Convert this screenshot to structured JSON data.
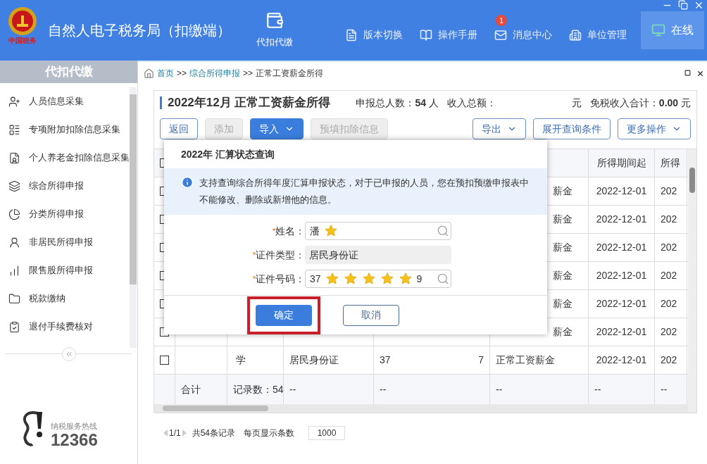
{
  "header": {
    "logo_caption": "中国税务",
    "title": "自然人电子税务局（扣缴端）",
    "module": {
      "label": "代扣代缴",
      "selected": true
    },
    "menu": [
      {
        "label": "版本切换"
      },
      {
        "label": "操作手册"
      },
      {
        "label": "消息中心",
        "badge": "1"
      },
      {
        "label": "单位管理"
      }
    ],
    "status": {
      "label": "在线",
      "online": true
    }
  },
  "sidebar": {
    "title": "代扣代缴",
    "items": [
      {
        "label": "人员信息采集"
      },
      {
        "label": "专项附加扣除信息采集"
      },
      {
        "label": "个人养老金扣除信息采集"
      },
      {
        "label": "综合所得申报"
      },
      {
        "label": "分类所得申报"
      },
      {
        "label": "非居民所得申报"
      },
      {
        "label": "限售股所得申报"
      },
      {
        "label": "税款缴纳"
      },
      {
        "label": "退付手续费核对"
      }
    ],
    "hotline": {
      "label": "纳税服务热线",
      "number": "12366"
    }
  },
  "breadcrumb": [
    {
      "label": "首页",
      "link": true
    },
    {
      "label": ">>",
      "link": false
    },
    {
      "label": "综合所得申报",
      "link": true
    },
    {
      "label": ">>",
      "link": false
    },
    {
      "label": "正常工资薪金所得",
      "link": false
    }
  ],
  "panel": {
    "title": "2022年12月 正常工资薪金所得",
    "summary": [
      "申报总人数：**54** 人",
      "收入总额：",
      "元",
      "免税收入合计：**0.00** 元"
    ],
    "toolbar": {
      "left": [
        {
          "label": "返回",
          "primary": false,
          "disabled": false,
          "dropdown": false
        },
        {
          "label": "添加",
          "primary": false,
          "disabled": true,
          "dropdown": false
        },
        {
          "label": "导入",
          "primary": true,
          "disabled": false,
          "dropdown": true
        },
        {
          "label": "预填扣除信息",
          "primary": false,
          "disabled": true,
          "dropdown": false
        }
      ],
      "right": [
        {
          "label": "导出",
          "primary": false,
          "disabled": false,
          "dropdown": true
        },
        {
          "label": "展开查询条件",
          "primary": false,
          "disabled": false,
          "dropdown": false
        },
        {
          "label": "更多操作",
          "primary": false,
          "disabled": false,
          "dropdown": true
        }
      ]
    },
    "table": {
      "header_checked": false,
      "columns": {
        "col7": "所得期间起",
        "col8": "所得"
      },
      "rows": [
        {
          "checked": false,
          "col6": "薪金",
          "col7": "2022-12-01",
          "col8": "202"
        },
        {
          "checked": false,
          "col6": "薪金",
          "col7": "2022-12-01",
          "col8": "202"
        },
        {
          "checked": false,
          "col6": "薪金",
          "col7": "2022-12-01",
          "col8": "202"
        },
        {
          "checked": false,
          "col6": "薪金",
          "col7": "2022-12-01",
          "col8": "202"
        },
        {
          "checked": false,
          "col6": "薪金",
          "col7": "2022-12-01",
          "col8": "202"
        },
        {
          "checked": false,
          "col6": "薪金",
          "col7": "2022-12-01",
          "col8": "202"
        },
        {
          "checked": false,
          "col3": "学",
          "col4": "居民身份证",
          "col5_start": "37",
          "col5_end": "7",
          "col6": "正常工资薪金",
          "col7": "2022-12-01",
          "col8": "202"
        }
      ],
      "total": {
        "col2": "合计",
        "col3": "记录数：54",
        "col4": "--",
        "col5": "--",
        "col6": "--",
        "col7": "--",
        "col8": "--"
      }
    },
    "pagination": {
      "page": "1/1",
      "records": "共54条记录",
      "per_page_label": "每页显示条数",
      "per_page": "1000"
    }
  },
  "dialog": {
    "title": "2022年 汇算状态查询",
    "info": "支持查询综合所得年度汇算申报状态，对于已申报的人员，您在预扣预缴申报表中不能修改、删除或新增他的信息。",
    "fields": [
      {
        "label": "姓名：",
        "required_mark": "*",
        "kind": "search",
        "value": [
          {
            "kind": "text",
            "text": "潘"
          },
          {
            "kind": "mask"
          }
        ]
      },
      {
        "label": "证件类型：",
        "required_mark": "*",
        "kind": "readonly",
        "value": [
          {
            "kind": "text",
            "text": "居民身份证"
          }
        ]
      },
      {
        "label": "证件号码：",
        "required_mark": "*",
        "kind": "search",
        "value": [
          {
            "kind": "text",
            "text": "37"
          },
          {
            "kind": "mask"
          },
          {
            "kind": "mask"
          },
          {
            "kind": "mask"
          },
          {
            "kind": "mask"
          },
          {
            "kind": "mask"
          },
          {
            "kind": "text",
            "text": "9"
          }
        ]
      }
    ],
    "buttons": [
      {
        "label": "确定",
        "primary": true,
        "highlighted": true
      },
      {
        "label": "取消",
        "primary": false,
        "highlighted": false
      }
    ]
  }
}
